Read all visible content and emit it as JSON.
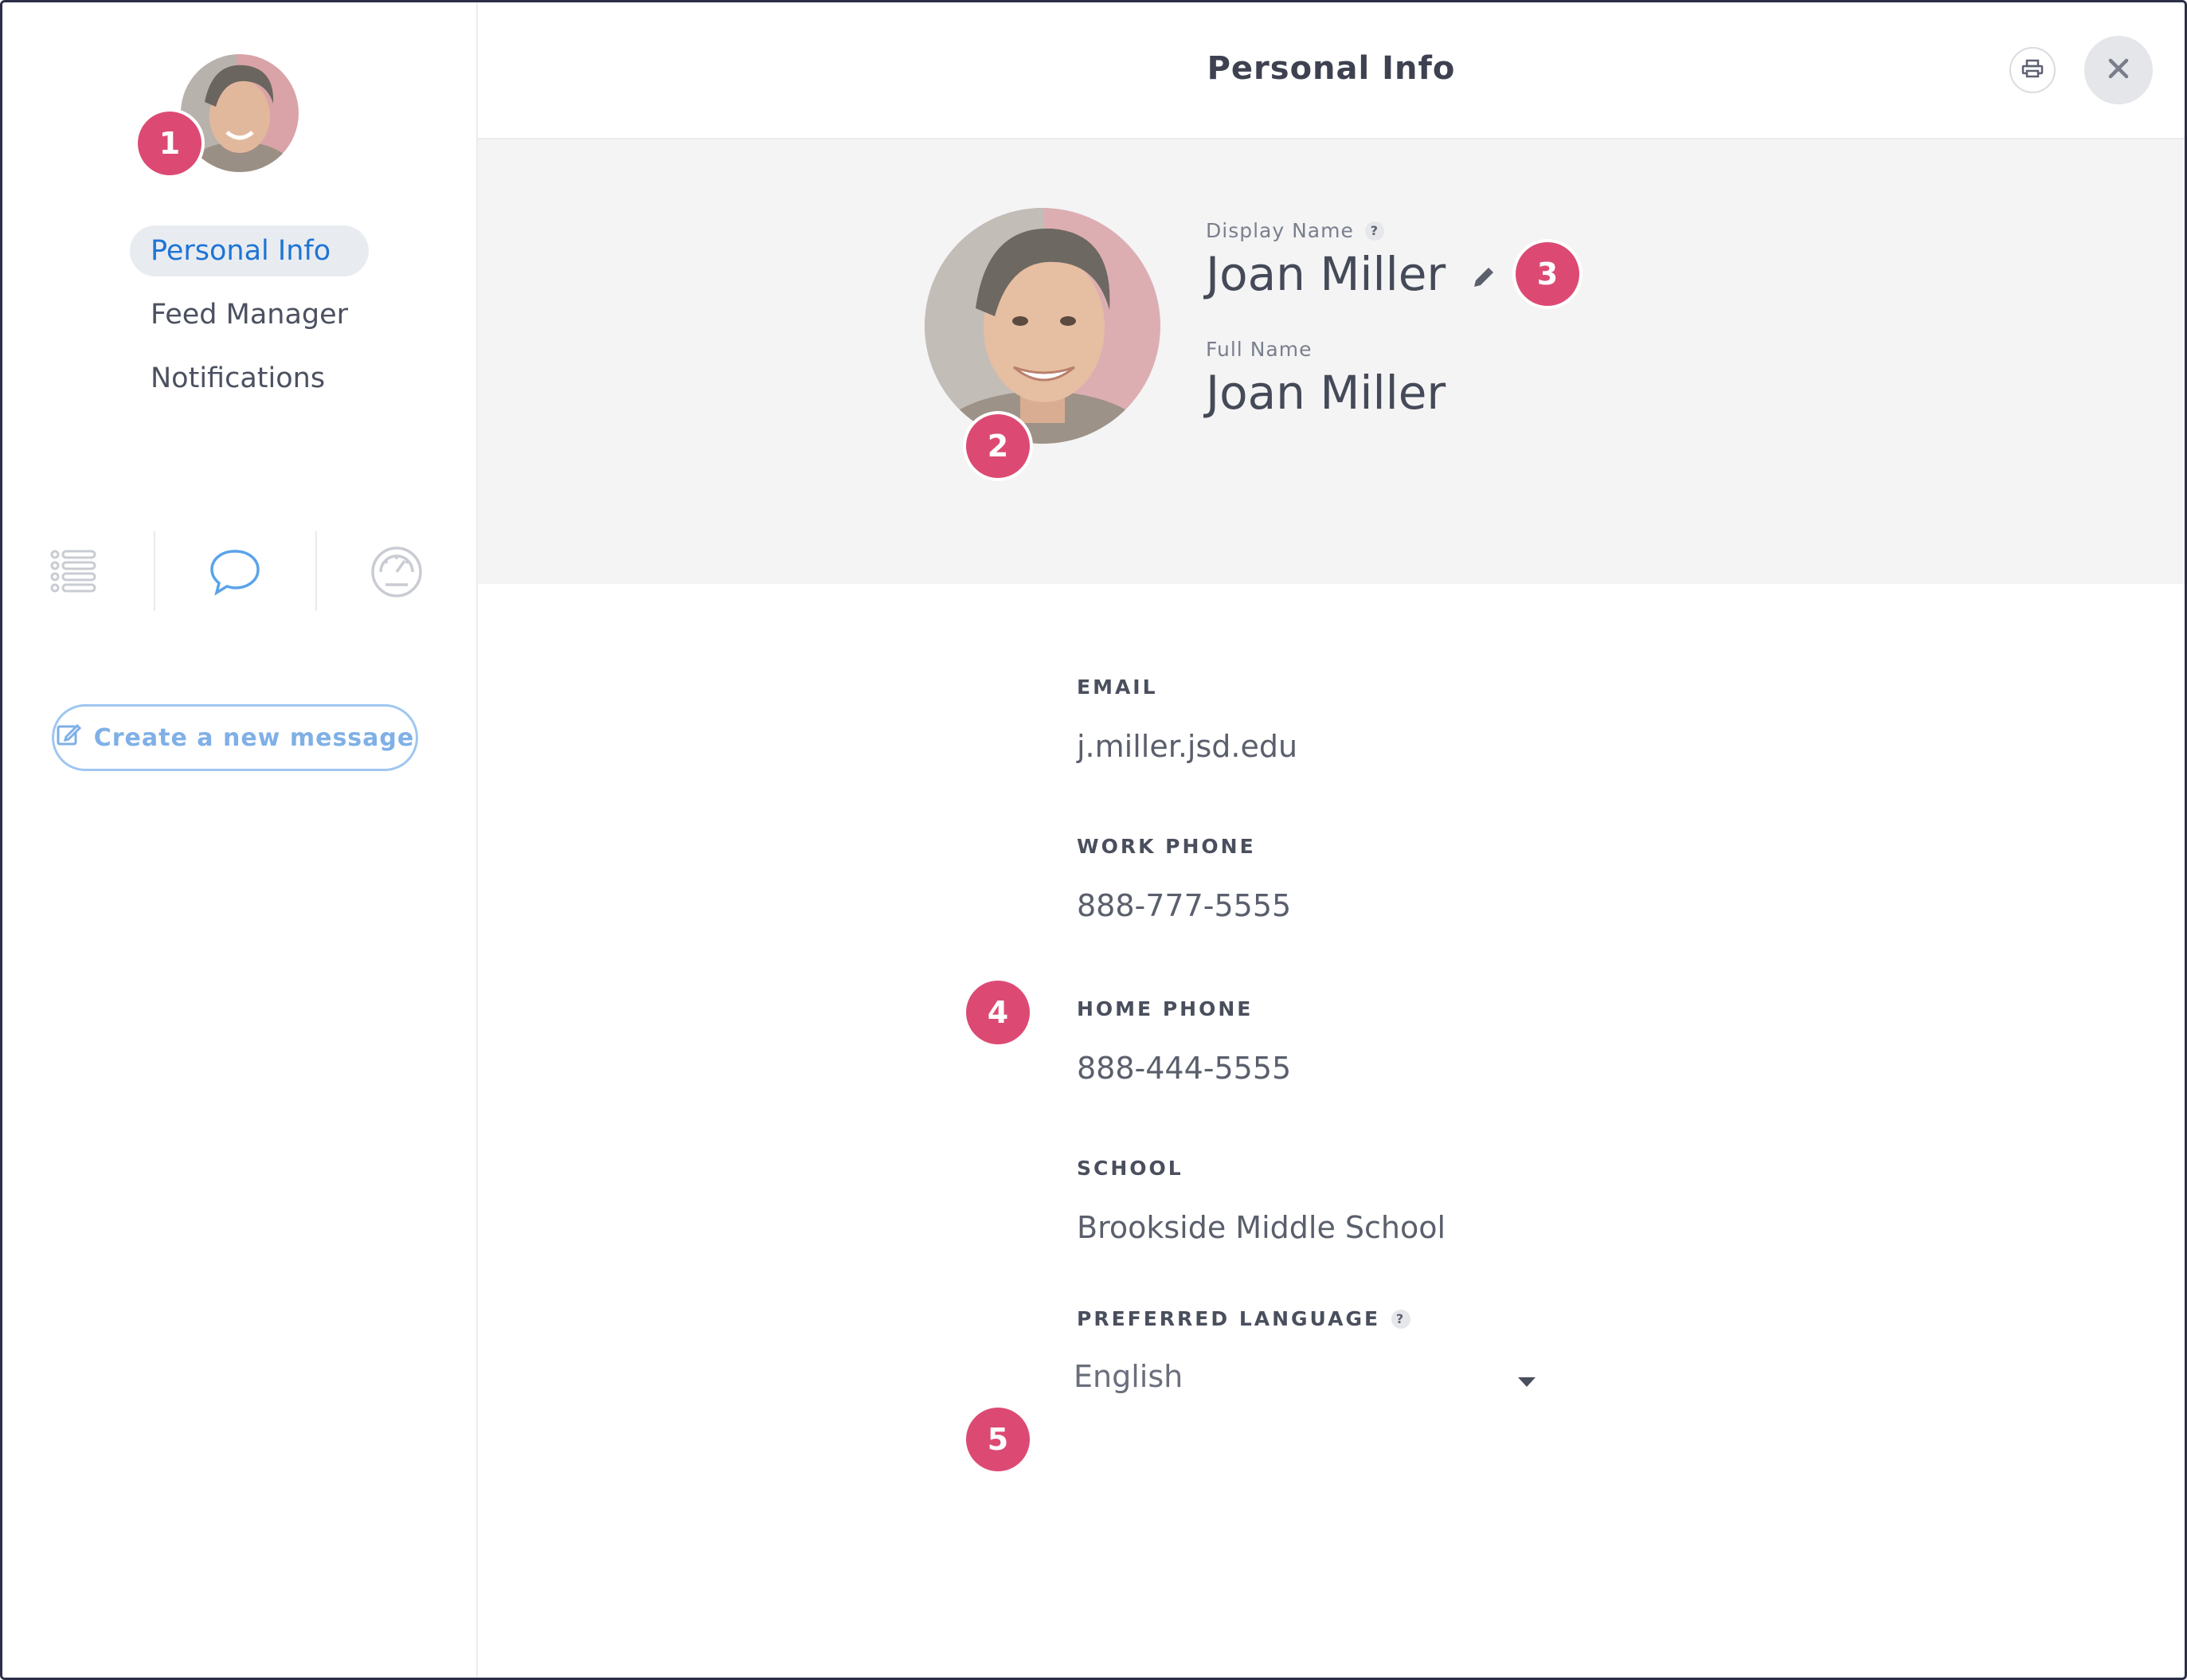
{
  "header": {
    "title": "Personal Info",
    "print_icon": "print-icon",
    "close_icon": "close-icon"
  },
  "sidebar": {
    "nav": [
      {
        "label": "Personal Info",
        "active": true
      },
      {
        "label": "Feed Manager",
        "active": false
      },
      {
        "label": "Notifications",
        "active": false
      }
    ],
    "tab_icons": [
      "list-icon",
      "chat-bubble-icon",
      "dashboard-gauge-icon"
    ],
    "new_message_label": "Create a new message"
  },
  "profile": {
    "display_name_label": "Display Name",
    "display_name": "Joan Miller",
    "full_name_label": "Full Name",
    "full_name": "Joan Miller",
    "help_mark": "?"
  },
  "fields": {
    "email_label": "EMAIL",
    "email_value": "j.miller.jsd.edu",
    "work_phone_label": "WORK PHONE",
    "work_phone_value": "888-777-5555",
    "home_phone_label": "HOME PHONE",
    "home_phone_value": "888-444-5555",
    "school_label": "SCHOOL",
    "school_value": "Brookside Middle School",
    "language_label": "PREFERRED LANGUAGE",
    "language_value": "English"
  },
  "callouts": [
    "1",
    "2",
    "3",
    "4",
    "5"
  ],
  "colors": {
    "accent": "#1f74d4",
    "callout": "#dc4a73",
    "hero_bg": "#f4f4f5",
    "active_nav_bg": "#e8ecf1"
  }
}
